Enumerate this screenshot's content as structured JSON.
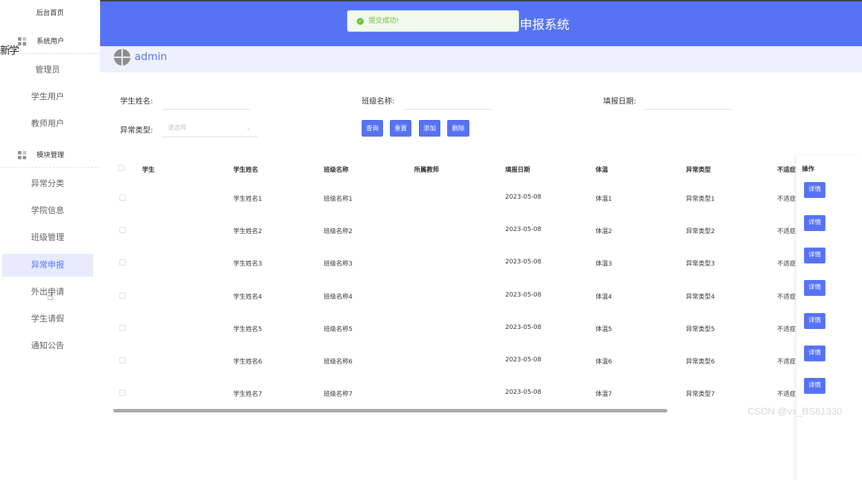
{
  "sidebar": {
    "home": "后台首页",
    "groups": [
      {
        "label": "系统用户",
        "icon": "grid-icon"
      },
      {
        "label": "模块管理",
        "icon": "grid-icon"
      }
    ],
    "items": [
      {
        "label": "管理员"
      },
      {
        "label": "学生用户"
      },
      {
        "label": "教师用户"
      },
      {
        "label": "异常分类"
      },
      {
        "label": "学院信息"
      },
      {
        "label": "班级管理"
      },
      {
        "label": "异常申报",
        "active": true
      },
      {
        "label": "外出申请"
      },
      {
        "label": "学生请假"
      },
      {
        "label": "通知公告"
      }
    ],
    "ghost_text": "新学"
  },
  "header": {
    "title": "申报系统",
    "toast": "提交成功!"
  },
  "user": {
    "name": "admin"
  },
  "filters": {
    "student_name_label": "学生姓名:",
    "class_name_label": "班级名称:",
    "report_date_label": "填报日期:",
    "anomaly_type_label": "异常类型:",
    "anomaly_type_placeholder": "请选择"
  },
  "buttons": {
    "query": "查询",
    "reset": "重置",
    "add": "添加",
    "delete": "删除"
  },
  "table": {
    "columns": [
      "学生",
      "学生姓名",
      "班级名称",
      "所属教师",
      "填报日期",
      "体温",
      "异常类型",
      "不适症",
      "操作"
    ],
    "rows": [
      {
        "name": "学生姓名1",
        "cls": "班级名称1",
        "date": "2023-05-08",
        "temp": "体温1",
        "type": "异常类型1",
        "sym": "不适症"
      },
      {
        "name": "学生姓名2",
        "cls": "班级名称2",
        "date": "2023-05-08",
        "temp": "体温2",
        "type": "异常类型2",
        "sym": "不适症"
      },
      {
        "name": "学生姓名3",
        "cls": "班级名称3",
        "date": "2023-05-08",
        "temp": "体温3",
        "type": "异常类型3",
        "sym": "不适症"
      },
      {
        "name": "学生姓名4",
        "cls": "班级名称4",
        "date": "2023-05-08",
        "temp": "体温4",
        "type": "异常类型4",
        "sym": "不适症"
      },
      {
        "name": "学生姓名5",
        "cls": "班级名称5",
        "date": "2023-05-08",
        "temp": "体温5",
        "type": "异常类型5",
        "sym": "不适症"
      },
      {
        "name": "学生姓名6",
        "cls": "班级名称6",
        "date": "2023-05-08",
        "temp": "体温6",
        "type": "异常类型6",
        "sym": "不适症"
      },
      {
        "name": "学生姓名7",
        "cls": "班级名称7",
        "date": "2023-05-08",
        "temp": "体温7",
        "type": "异常类型7",
        "sym": "不适症"
      }
    ],
    "detail_label": "详情"
  },
  "watermark": "CSDN @vx_BS81330",
  "colors": {
    "primary": "#5773f5",
    "success": "#67c23a",
    "active_bg": "#e6ebfd"
  }
}
